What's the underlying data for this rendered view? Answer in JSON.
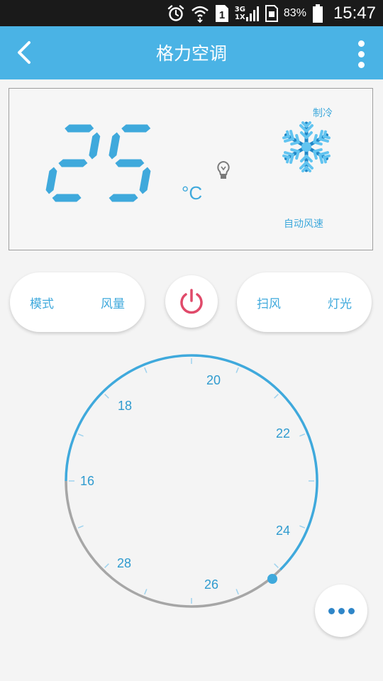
{
  "status_bar": {
    "network_top": "3G",
    "network_bottom": "1X",
    "sim": "1",
    "battery": "83%",
    "time": "15:47"
  },
  "header": {
    "title": "格力空调"
  },
  "display": {
    "temperature": "25",
    "unit": "°C",
    "mode": "制冷",
    "fan": "自动风速"
  },
  "controls": {
    "mode": "模式",
    "fan_speed": "风量",
    "swing": "扫风",
    "light": "灯光"
  },
  "dial": {
    "labels": {
      "t20": "20",
      "t22": "22",
      "t24": "24",
      "t26": "26",
      "t28": "28",
      "t16": "16",
      "t18": "18"
    }
  },
  "colors": {
    "accent": "#4ab3e5",
    "display_blue": "#3fa9dc",
    "power_red": "#e04a6a",
    "dial_gray": "#a6a6a6"
  },
  "icons": {
    "back": "chevron-left-icon",
    "menu": "more-vertical-icon",
    "power": "power-icon",
    "mode": "snowflake-icon",
    "light": "bulb-icon",
    "more": "more-horizontal-icon"
  }
}
